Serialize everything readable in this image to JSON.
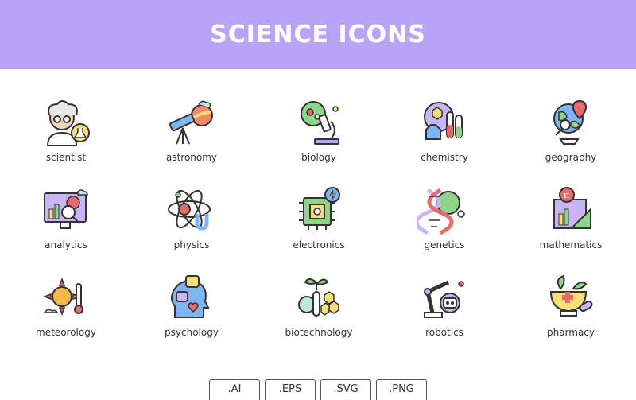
{
  "header": {
    "title": "SCIENCE ICONS",
    "background": "#b9a3f6"
  },
  "icons": [
    {
      "label": "scientist",
      "icon": "scientist-icon"
    },
    {
      "label": "astronomy",
      "icon": "telescope-icon"
    },
    {
      "label": "biology",
      "icon": "microscope-icon"
    },
    {
      "label": "chemistry",
      "icon": "test-tubes-icon"
    },
    {
      "label": "geography",
      "icon": "globe-icon"
    },
    {
      "label": "analytics",
      "icon": "analytics-monitor-icon"
    },
    {
      "label": "physics",
      "icon": "atom-icon"
    },
    {
      "label": "electronics",
      "icon": "chip-icon"
    },
    {
      "label": "genetics",
      "icon": "dna-icon"
    },
    {
      "label": "mathematics",
      "icon": "math-ruler-icon"
    },
    {
      "label": "meteorology",
      "icon": "sun-thermometer-icon"
    },
    {
      "label": "psychology",
      "icon": "head-emotions-icon"
    },
    {
      "label": "biotechnology",
      "icon": "plant-molecule-icon"
    },
    {
      "label": "robotics",
      "icon": "robot-arm-icon"
    },
    {
      "label": "pharmacy",
      "icon": "mortar-pestle-icon"
    }
  ],
  "formats": [
    ".AI",
    ".EPS",
    ".SVG",
    ".PNG"
  ]
}
